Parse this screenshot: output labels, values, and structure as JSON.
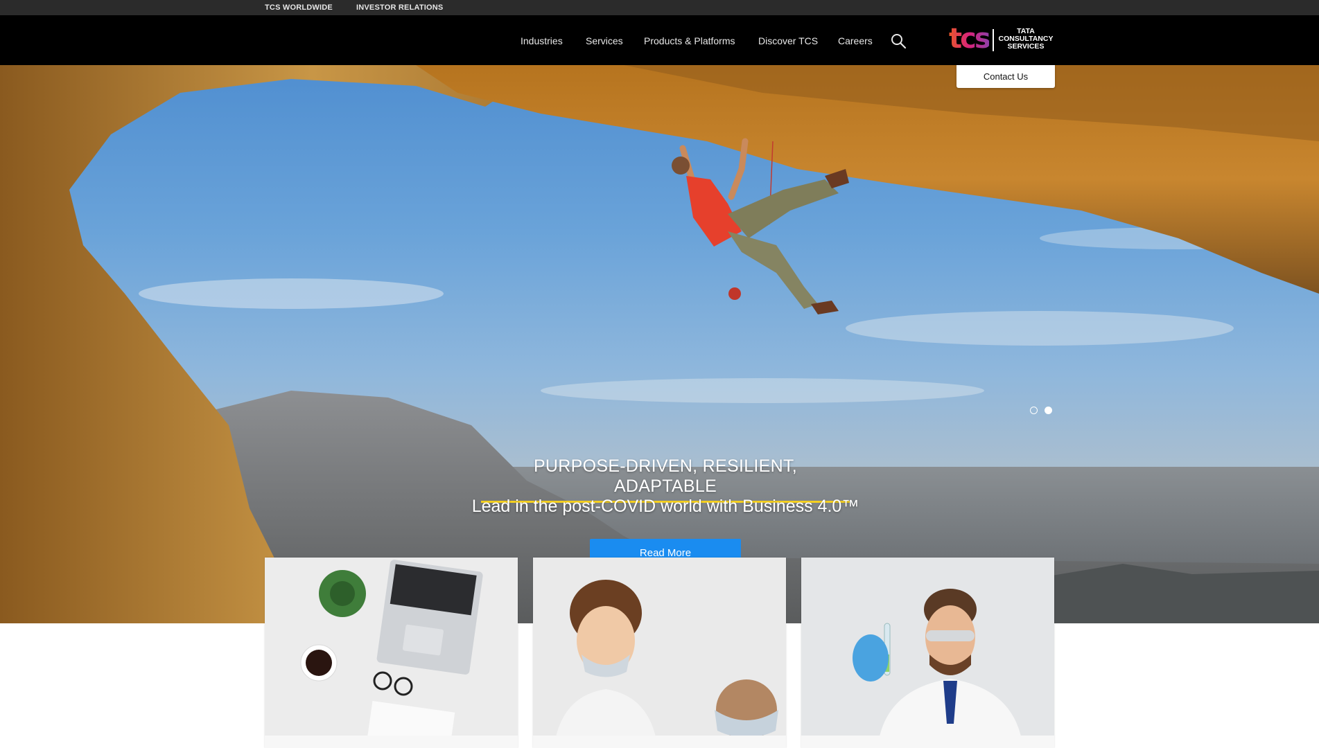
{
  "utility": {
    "links": [
      "TCS WORLDWIDE",
      "INVESTOR RELATIONS"
    ]
  },
  "nav": {
    "items": [
      "Industries",
      "Services",
      "Products & Platforms",
      "Discover TCS",
      "Careers"
    ],
    "search_icon": "search-icon"
  },
  "logo": {
    "mark": "tcs",
    "line1": "TATA",
    "line2": "CONSULTANCY",
    "line3": "SERVICES"
  },
  "contact": {
    "label": "Contact Us"
  },
  "hero": {
    "headline": "PURPOSE-DRIVEN, RESILIENT, ADAPTABLE",
    "subheadline": "Lead in the post-COVID world with Business 4.0™",
    "cta_label": "Read More",
    "slides_total": 2,
    "active_slide": 2
  },
  "colors": {
    "nav_bg": "#000000",
    "utility_bg": "#2b2b2b",
    "cta_blue": "#1a8cf0",
    "headline_underline": "#f5d020"
  }
}
